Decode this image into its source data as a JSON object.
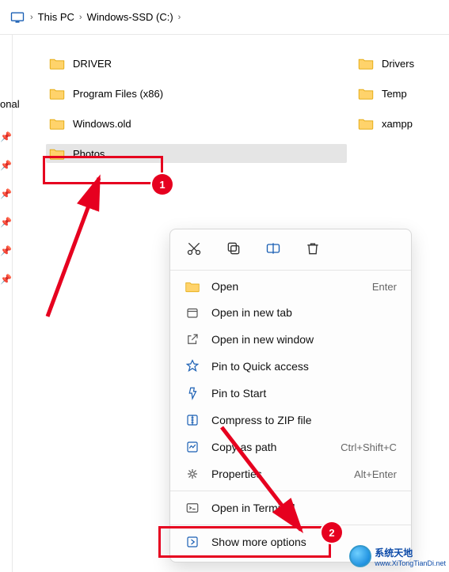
{
  "breadcrumb": {
    "root": "This PC",
    "drive": "Windows-SSD (C:)"
  },
  "sidebar": {
    "label": "onal"
  },
  "files": {
    "col1": [
      {
        "name": "DRIVER"
      },
      {
        "name": "Program Files (x86)"
      },
      {
        "name": "Windows.old"
      },
      {
        "name": "Photos",
        "selected": true
      }
    ],
    "col2": [
      {
        "name": "Drivers"
      },
      {
        "name": "Temp"
      },
      {
        "name": "xampp"
      }
    ]
  },
  "ctx": {
    "open": {
      "label": "Open",
      "hotkey": "Enter"
    },
    "open_tab": {
      "label": "Open in new tab"
    },
    "open_window": {
      "label": "Open in new window"
    },
    "pin_quick": {
      "label": "Pin to Quick access"
    },
    "pin_start": {
      "label": "Pin to Start"
    },
    "compress": {
      "label": "Compress to ZIP file"
    },
    "copy_path": {
      "label": "Copy as path",
      "hotkey": "Ctrl+Shift+C"
    },
    "properties": {
      "label": "Properties",
      "hotkey": "Alt+Enter"
    },
    "terminal": {
      "label": "Open in Terminal"
    },
    "show_more": {
      "label": "Show more options"
    }
  },
  "annotations": {
    "badge1": "1",
    "badge2": "2"
  },
  "watermark": {
    "title": "系统天地",
    "sub": "www.XiTongTianDi.net"
  }
}
